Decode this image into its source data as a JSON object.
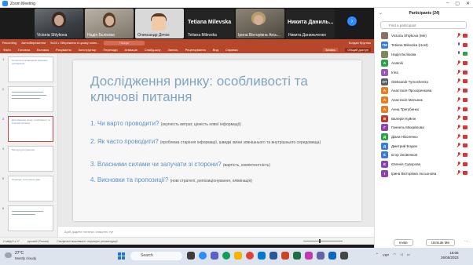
{
  "zoom": {
    "window_title": "Zoom Meeting",
    "controls": [
      "–",
      "▢",
      "✕"
    ]
  },
  "video_tiles": [
    {
      "name": "Victoria Shlykova"
    },
    {
      "name": "Надія Бєлікова"
    },
    {
      "name": "Олександр Дячок"
    },
    {
      "name": "Tetiana Milevska"
    },
    {
      "name": "Ірина Вікторівна Аксь..."
    },
    {
      "name": "Никита Данильченко"
    }
  ],
  "video_big_labels": [
    "Tetiana Milevska",
    "Никита Даниль..."
  ],
  "next_page_icon": "chevron-right-icon",
  "ppt": {
    "top_bar": {
      "left": "Recording",
      "autosave": "Автозбереження",
      "doc": "9v28 • Збережено в цьому комп...",
      "search_hint": "Пошук",
      "user": "Богдан Кругляк"
    },
    "menu": [
      "Файл",
      "Головна",
      "Вставка",
      "Рисування",
      "Конструктор",
      "Переходи",
      "Анімація",
      "Слайд-шоу",
      "Запись",
      "Рецензування",
      "Вид",
      "Справка"
    ],
    "menu_selected": 0,
    "record_btn": "Запись",
    "share_btn": "Общий доступ",
    "thumbnails": [
      {
        "num": "1",
        "title": "Технологія проведення ринкових досліджень"
      },
      {
        "num": "2",
        "title": ""
      },
      {
        "num": "3",
        "title": "Дослідження ринку: особливості та ключові питання"
      },
      {
        "num": "4",
        "title": "Методи дослідження"
      },
      {
        "num": "5",
        "title": "Первинні та вторинні дані"
      },
      {
        "num": "6",
        "title": ""
      }
    ],
    "slide": {
      "title": "Дослідження ринку: особливості та ключові питання",
      "questions": [
        {
          "q": "1. Чи варто проводити?",
          "note": "(окупність витрат, цінність нової інформації)"
        },
        {
          "q": "2. Як часто проводити?",
          "note": "(проблема старіння інформації, швидкі зміни зовнішнього та внутрішнього середовища)"
        },
        {
          "q": "3. Власними силами чи залучати зі сторони?",
          "note": "(вартість, компетентність)"
        },
        {
          "q": "4. Висновки та пропозиції?",
          "note": "(нові стратегії, репозиціонування, елімінація)"
        }
      ]
    },
    "notes_placeholder": "Щоб додати нотатки, клацніть тут",
    "status": {
      "slide_of": "Слайд 3 з 17",
      "language": "русский (Россия)",
      "accessibility": "Спеціальні можливості: перевірте рекомендації"
    }
  },
  "participants": {
    "header": "Participants (24)",
    "search_placeholder": "Find a participant",
    "list": [
      {
        "initials": "",
        "name": "Victoria Shlykova (Me)",
        "color": "#8c6f5e",
        "mic": false,
        "cam": false
      },
      {
        "initials": "TM",
        "name": "Tetiana Milevska (Host)",
        "color": "#3a7bd5",
        "mic": true,
        "cam": false
      },
      {
        "initials": "",
        "name": "Надія Бєлікова",
        "color": "#7c8a5a",
        "mic": true,
        "cam": true
      },
      {
        "initials": "A",
        "name": "Anatolii",
        "color": "#2ba34b",
        "mic": false,
        "cam": false
      },
      {
        "initials": "I",
        "name": "Irina",
        "color": "#9b59b6",
        "mic": false,
        "cam": false
      },
      {
        "initials": "OT",
        "name": "Oleksandr Tymoshenko",
        "color": "#555d66",
        "mic": false,
        "cam": false
      },
      {
        "initials": "А",
        "name": "Анастасія Прозоренкова",
        "color": "#e67e22",
        "mic": false,
        "cam": false
      },
      {
        "initials": "А",
        "name": "Анастасія Мельник",
        "color": "#e67e22",
        "mic": false,
        "cam": false
      },
      {
        "initials": "А",
        "name": "Анна Трегубенко",
        "color": "#e67e22",
        "mic": false,
        "cam": false
      },
      {
        "initials": "В",
        "name": "Валерія Куйнін",
        "color": "#c0392b",
        "mic": false,
        "cam": false
      },
      {
        "initials": "Г",
        "name": "Ганнель Михайлова",
        "color": "#8e44ad",
        "mic": false,
        "cam": false
      },
      {
        "initials": "Д",
        "name": "Діана Ніколенко",
        "color": "#2ba34b",
        "mic": false,
        "cam": false
      },
      {
        "initials": "Д",
        "name": "Дмитрий Бодюк",
        "color": "#3a7bd5",
        "mic": false,
        "cam": false
      },
      {
        "initials": "Є",
        "name": "Єгор Зновенков",
        "color": "#3a7bd5",
        "mic": false,
        "cam": false
      },
      {
        "initials": "Є",
        "name": "Євгенія Суворова",
        "color": "#8e44ad",
        "mic": false,
        "cam": false
      },
      {
        "initials": "І",
        "name": "Ірина Вікторівна Аксьонова",
        "color": "#8e44ad",
        "mic": false,
        "cam": false
      }
    ],
    "invite": "Invite",
    "unmute": "Unmute Me"
  },
  "taskbar": {
    "temp": "27°C",
    "weather": "Mostly cloudy",
    "search": "Search",
    "tray_lang": "УКР",
    "time": "16:08",
    "date": "26/05/2023"
  }
}
